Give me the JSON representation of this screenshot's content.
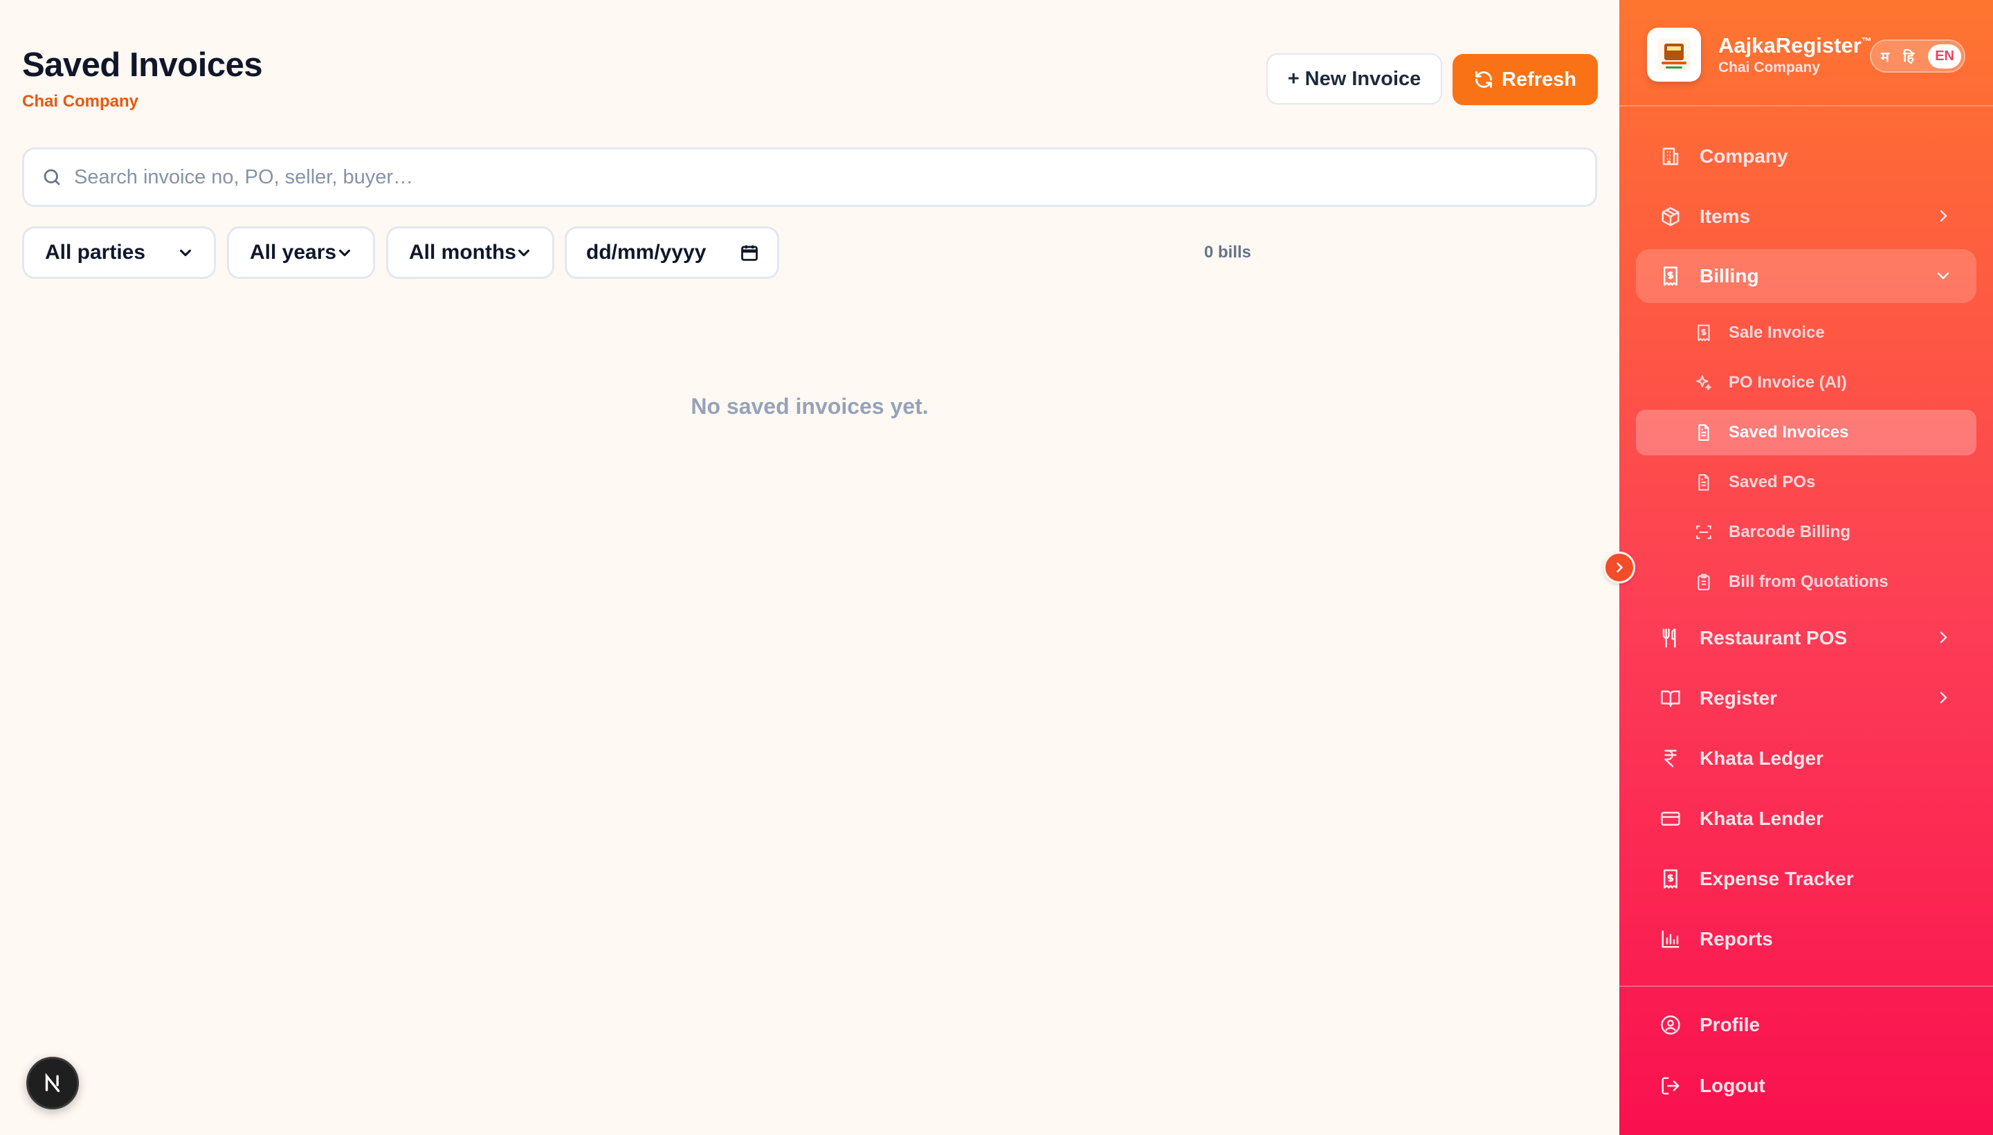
{
  "header": {
    "title": "Saved Invoices",
    "company": "Chai Company",
    "new_invoice_label": "+ New Invoice",
    "refresh_label": "Refresh"
  },
  "search": {
    "placeholder": "Search invoice no, PO, seller, buyer…"
  },
  "filters": {
    "parties": "All parties",
    "years": "All years",
    "months": "All months",
    "date_placeholder": "dd/mm/yyyy"
  },
  "bill_count": "0 bills",
  "empty_message": "No saved invoices yet.",
  "sidebar": {
    "brand": "AajkaRegister",
    "trademark": "™",
    "company": "Chai Company",
    "languages": [
      "म",
      "हि",
      "EN"
    ],
    "active_language": "EN",
    "items": [
      {
        "label": "Company",
        "icon": "building-icon"
      },
      {
        "label": "Items",
        "icon": "box-icon"
      },
      {
        "label": "Billing",
        "icon": "receipt-icon"
      },
      {
        "label": "Restaurant POS",
        "icon": "utensils-icon"
      },
      {
        "label": "Register",
        "icon": "book-open-icon"
      },
      {
        "label": "Khata Ledger",
        "icon": "rupee-icon"
      },
      {
        "label": "Khata Lender",
        "icon": "credit-card-icon"
      },
      {
        "label": "Expense Tracker",
        "icon": "receipt-icon"
      },
      {
        "label": "Reports",
        "icon": "bar-chart-icon"
      },
      {
        "label": "Profile",
        "icon": "user-circle-icon"
      },
      {
        "label": "Logout",
        "icon": "logout-icon"
      }
    ],
    "billing_subitems": [
      {
        "label": "Sale Invoice",
        "icon": "receipt-icon"
      },
      {
        "label": "PO Invoice (AI)",
        "icon": "sparkles-icon"
      },
      {
        "label": "Saved Invoices",
        "icon": "file-text-icon"
      },
      {
        "label": "Saved POs",
        "icon": "file-text-icon"
      },
      {
        "label": "Barcode Billing",
        "icon": "scan-icon"
      },
      {
        "label": "Bill from Quotations",
        "icon": "clipboard-icon"
      }
    ]
  },
  "colors": {
    "accent": "#f97316",
    "sidebar_top": "#fe7530",
    "sidebar_bottom": "#f9104f",
    "company_text": "#ea580c"
  }
}
